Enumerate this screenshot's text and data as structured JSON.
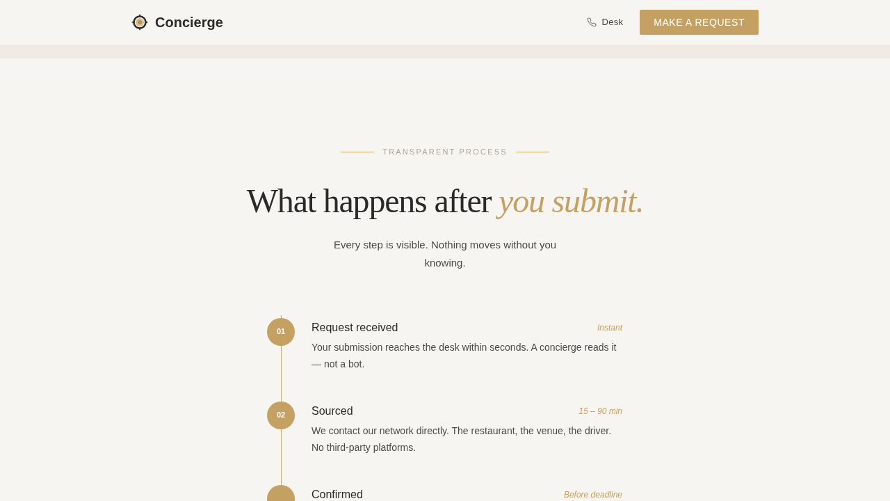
{
  "header": {
    "brand": "Concierge",
    "desk_link": "Desk",
    "cta": "MAKE A REQUEST"
  },
  "process": {
    "eyebrow": "TRANSPARENT PROCESS",
    "heading": "What happens after *you submit.*",
    "intro": "Every step is visible. Nothing moves without you knowing.",
    "steps": [
      {
        "number": "01",
        "title": "Request received",
        "timing": "Instant",
        "description": "Your submission reaches the desk within seconds. A concierge reads it — not a bot."
      },
      {
        "number": "02",
        "title": "Sourced",
        "timing": "15 – 90 min",
        "description": "We contact our network directly. The restaurant, the venue, the driver. No third-party platforms."
      },
      {
        "title": "Confirmed",
        "timing": "Before deadline"
      }
    ]
  }
}
